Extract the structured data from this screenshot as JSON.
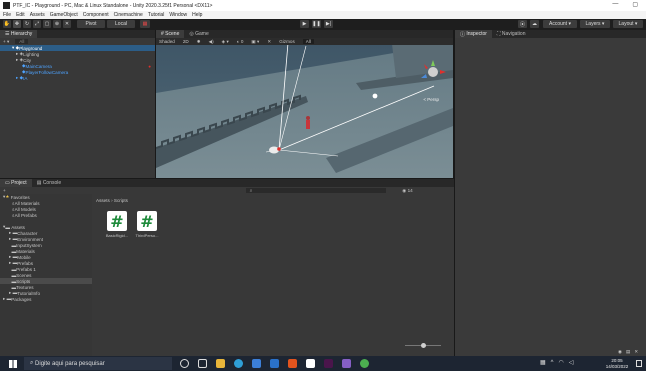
{
  "window": {
    "title": "PTF_IC - Playground - PC, Mac & Linux Standalone - Unity 2020.3.25f1 Personal <DX11>",
    "controls": [
      "—",
      "▢"
    ]
  },
  "menu": [
    "File",
    "Edit",
    "Assets",
    "GameObject",
    "Component",
    "Cinemachine",
    "Tutorial",
    "Window",
    "Help"
  ],
  "toolbar": {
    "pivot_label": "Pivot",
    "local_label": "Local",
    "account_label": "Account",
    "layers_label": "Layers",
    "layout_label": "Layout"
  },
  "hierarchy": {
    "tab": "Hierarchy",
    "search_placeholder": "All",
    "items": [
      {
        "label": "Playground",
        "indent": 1,
        "selected": true
      },
      {
        "label": "Lighting",
        "indent": 2
      },
      {
        "label": "City",
        "indent": 2
      },
      {
        "label": "MainCamera",
        "indent": 3,
        "blue": true
      },
      {
        "label": "PlayerFollowCamera",
        "indent": 3,
        "blue": true
      },
      {
        "label": "IA",
        "indent": 2,
        "blue": true
      }
    ]
  },
  "scene": {
    "tabs": [
      "Scene",
      "Game"
    ],
    "shading": "Shaded",
    "mode": "2D",
    "gizmos_label": "Gizmos",
    "search_placeholder": "All",
    "persp_label": "< Persp"
  },
  "inspector": {
    "tabs": [
      "Inspector",
      "Navigation"
    ]
  },
  "project": {
    "tabs": [
      "Project",
      "Console"
    ],
    "add_label": "+",
    "count_label": "14",
    "favorites": {
      "label": "Favorites",
      "items": [
        "All Materials",
        "All Models",
        "All Prefabs"
      ]
    },
    "assets": {
      "label": "Assets",
      "items": [
        "Character",
        "Environment",
        "InputSystem",
        "Materials",
        "Mobile",
        "Prefabs",
        "Prefabs 1",
        "Scenes",
        "Scripts",
        "Textures",
        "TutorialInfo"
      ],
      "selected": "Scripts"
    },
    "packages_label": "Packages",
    "breadcrumb": [
      "Assets",
      "Scripts"
    ],
    "files": [
      {
        "name": "BasicRigid...",
        "icon": "csharp-script-icon"
      },
      {
        "name": "ThirdPerso...",
        "icon": "csharp-script-icon"
      }
    ]
  },
  "taskbar": {
    "search_placeholder": "Digite aqui para pesquisar",
    "time": "20:05",
    "date": "14/03/2022"
  },
  "colors": {
    "accent": "#2c5d87",
    "script_green": "#1d8a3a",
    "gizmo_red": "#e0302c"
  }
}
